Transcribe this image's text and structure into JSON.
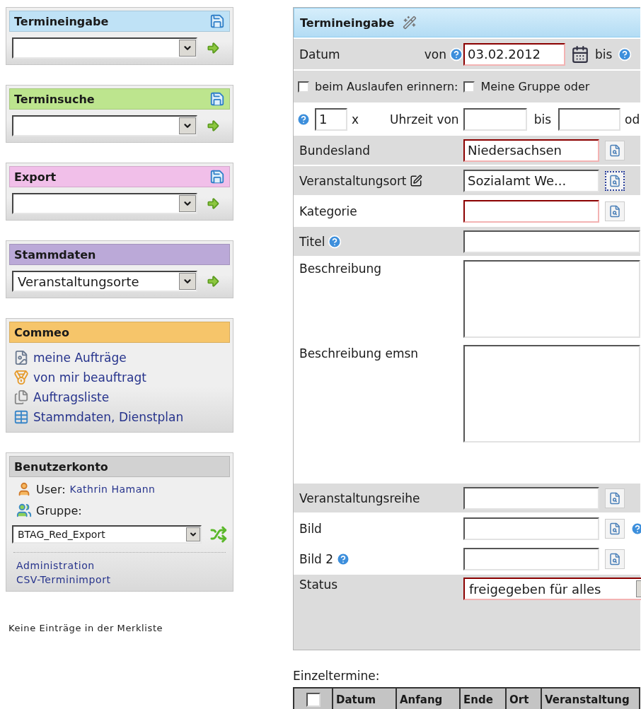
{
  "sidebar": {
    "panels": [
      {
        "kind": "select",
        "title": "Termineingabe",
        "color": "#bfe2f6",
        "save": true
      },
      {
        "kind": "select",
        "title": "Terminsuche",
        "color": "#bde58e",
        "save": true
      },
      {
        "kind": "select",
        "title": "Export",
        "color": "#f1bfe9",
        "save": true
      },
      {
        "kind": "select",
        "title": "Stammdaten",
        "color": "#bba9d8",
        "save": false,
        "value": "Veranstaltungsorte"
      },
      {
        "kind": "links",
        "title": "Commeo",
        "color": "#f6c56a",
        "save": false,
        "links": [
          "meine Aufträge",
          "von mir beauftragt",
          "Auftragsliste",
          "Stammdaten, Dienstplan"
        ]
      },
      {
        "kind": "account",
        "title": "Benutzerkonto",
        "color": "#d2d2d2",
        "save": false,
        "user_label": "User:",
        "user": "Kathrin Hamann",
        "group_label": "Gruppe:",
        "group": "BTAG_Red_Export",
        "links": [
          "Administration",
          "CSV-Terminimport"
        ]
      }
    ],
    "note": "Keine Einträge in der Merkliste"
  },
  "form": {
    "title": "Termineingabe",
    "rows": [
      {
        "kind": "date",
        "label": "Datum",
        "from_label": "von",
        "from": "03.02.2012",
        "to_label": "bis",
        "required": true,
        "shaded": true
      },
      {
        "kind": "checks",
        "shaded": true,
        "checks": [
          {
            "label": "beim Auslaufen erinnern:",
            "checked": false
          },
          {
            "label": "Meine Gruppe oder",
            "checked": false
          }
        ]
      },
      {
        "kind": "time",
        "shaded": false,
        "count": "1",
        "count_suffix": "x",
        "from_label": "Uhrzeit von",
        "to_label": "bis",
        "tail": "od"
      },
      {
        "kind": "lookup",
        "label": "Bundesland",
        "value": "Niedersachsen",
        "required": true,
        "shaded": true
      },
      {
        "kind": "lookup",
        "label": "Veranstaltungsort",
        "value": "Sozialamt We...",
        "required": false,
        "shaded": true,
        "edit": true,
        "focused": true
      },
      {
        "kind": "lookup",
        "label": "Kategorie",
        "required": true,
        "shaded": false
      },
      {
        "kind": "text",
        "label": "Titel",
        "help": true,
        "required": false,
        "shaded": true
      },
      {
        "kind": "textarea",
        "label": "Beschreibung",
        "shaded": false
      },
      {
        "kind": "textarea",
        "label": "Beschreibung emsn",
        "shaded": false
      },
      {
        "kind": "lookup",
        "label": "Veranstaltungsreihe",
        "required": false,
        "shaded": true
      },
      {
        "kind": "lookup",
        "label": "Bild",
        "required": false,
        "help_after": true,
        "shaded": false
      },
      {
        "kind": "lookup",
        "label": "Bild 2",
        "required": false,
        "help": true,
        "shaded": false
      },
      {
        "kind": "select",
        "label": "Status",
        "value": "freigegeben für alles",
        "required": true,
        "shaded": true
      }
    ]
  },
  "singles": {
    "title": "Einzeltermine:",
    "all_checked": false,
    "columns": [
      "Datum",
      "Anfang",
      "Ende",
      "Ort",
      "Veranstaltung"
    ]
  }
}
